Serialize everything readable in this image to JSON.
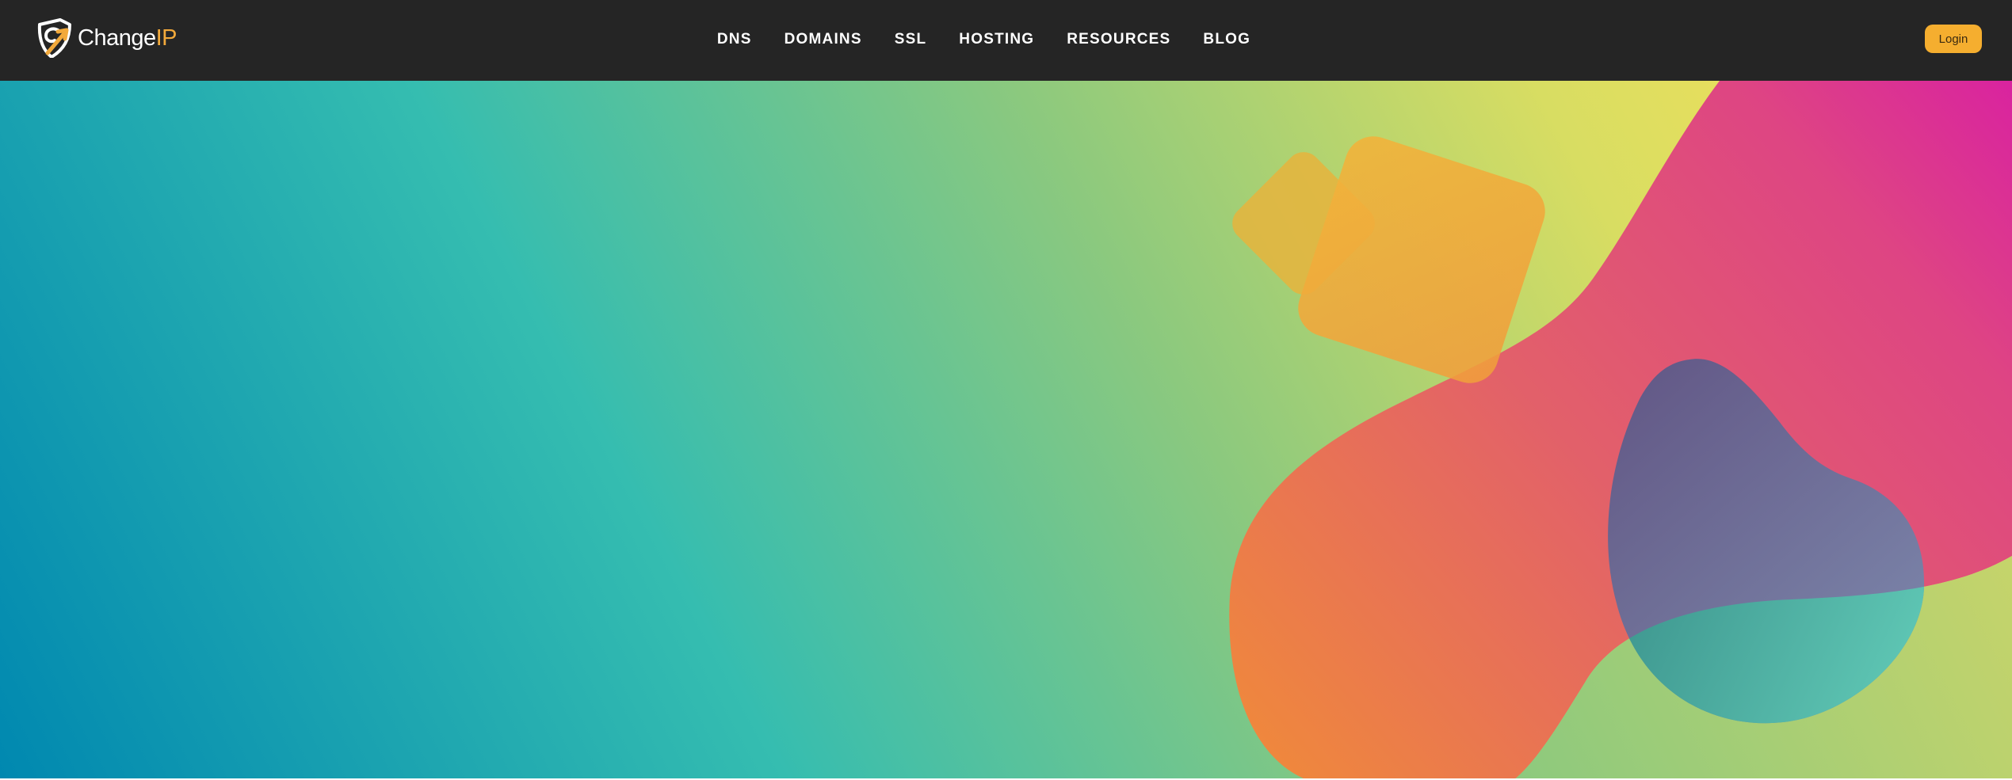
{
  "header": {
    "logo": {
      "icon": "shield-logo-icon",
      "text_main": "Change",
      "text_accent": "IP"
    },
    "nav": [
      {
        "label": "DNS"
      },
      {
        "label": "DOMAINS"
      },
      {
        "label": "SSL"
      },
      {
        "label": "HOSTING"
      },
      {
        "label": "RESOURCES"
      },
      {
        "label": "BLOG"
      }
    ],
    "login_label": "Login"
  },
  "colors": {
    "header_bg": "#252525",
    "accent": "#f5ae2f",
    "hero_teal": "#35bdb0",
    "hero_blue": "#0088b0",
    "hero_pink": "#d42a9d",
    "hero_lime": "#c3d46a",
    "hero_orange": "#f08a3a",
    "hero_purple": "#5b5b8c"
  }
}
